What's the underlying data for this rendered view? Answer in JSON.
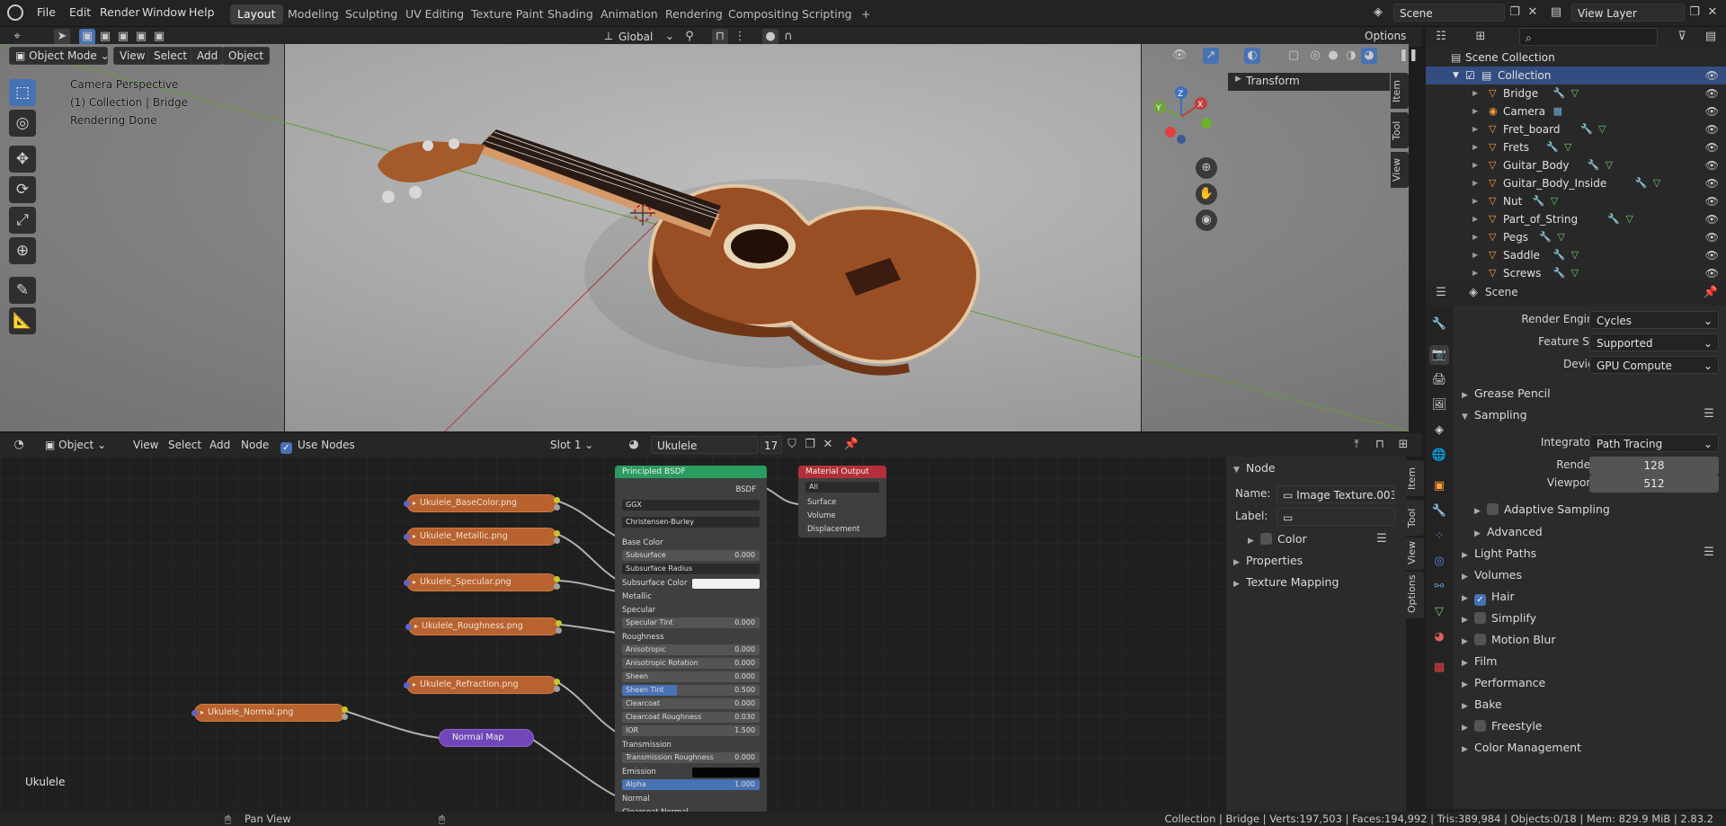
{
  "topbar": {
    "menus": [
      "File",
      "Edit",
      "Render",
      "Window",
      "Help"
    ],
    "workspaces": [
      "Layout",
      "Modeling",
      "Sculpting",
      "UV Editing",
      "Texture Paint",
      "Shading",
      "Animation",
      "Rendering",
      "Compositing",
      "Scripting"
    ],
    "active_workspace": "Layout",
    "scene": "Scene",
    "view_layer": "View Layer"
  },
  "viewport": {
    "header": {
      "orientation": "Global",
      "options": "Options"
    },
    "mode": "Object Mode",
    "menus": [
      "View",
      "Select",
      "Add",
      "Object"
    ],
    "overlay": [
      "Camera Perspective",
      "(1) Collection | Bridge",
      "Rendering Done"
    ],
    "side_tabs": [
      "Item",
      "Tool",
      "View"
    ],
    "transform_panel": "Transform"
  },
  "outliner": {
    "root": "Scene Collection",
    "collection": "Collection",
    "items": [
      "Bridge",
      "Camera",
      "Fret_board",
      "Frets",
      "Guitar_Body",
      "Guitar_Body_Inside",
      "Nut",
      "Part_of_String",
      "Pegs",
      "Saddle",
      "Screws"
    ]
  },
  "properties": {
    "scene": "Scene",
    "render_engine_label": "Render Engine",
    "render_engine": "Cycles",
    "feature_set_label": "Feature Set",
    "feature_set": "Supported",
    "device_label": "Device",
    "device": "GPU Compute",
    "grease_pencil": "Grease Pencil",
    "sampling": "Sampling",
    "integrator_label": "Integrator",
    "integrator": "Path Tracing",
    "render_label": "Render",
    "render_samples": "128",
    "viewport_label": "Viewport",
    "viewport_samples": "512",
    "adaptive_sampling": "Adaptive Sampling",
    "advanced": "Advanced",
    "light_paths": "Light Paths",
    "volumes": "Volumes",
    "hair": "Hair",
    "simplify": "Simplify",
    "motion_blur": "Motion Blur",
    "film": "Film",
    "performance": "Performance",
    "bake": "Bake",
    "freestyle": "Freestyle",
    "color_management": "Color Management"
  },
  "node_editor": {
    "type": "Object",
    "menus": [
      "View",
      "Select",
      "Add",
      "Node"
    ],
    "use_nodes": "Use Nodes",
    "slot": "Slot 1",
    "material": "Ukulele",
    "users": "17",
    "label_bottom": "Ukulele",
    "textures": [
      "Ukulele_BaseColor.png",
      "Ukulele_Metallic.png",
      "Ukulele_Specular.png",
      "Ukulele_Roughness.png",
      "Ukulele_Refraction.png",
      "Ukulele_Normal.png"
    ],
    "normal_map": "Normal Map",
    "bsdf": {
      "title": "Principled BSDF",
      "out": "BSDF",
      "dist": "GGX",
      "sss": "Christensen-Burley",
      "rows": [
        {
          "t": "socket",
          "l": "Base Color"
        },
        {
          "t": "field",
          "l": "Subsurface",
          "v": "0.000"
        },
        {
          "t": "field",
          "l": "Subsurface Radius",
          "v": ""
        },
        {
          "t": "socket",
          "l": "Subsurface Color"
        },
        {
          "t": "socket",
          "l": "Metallic"
        },
        {
          "t": "socket",
          "l": "Specular"
        },
        {
          "t": "field",
          "l": "Specular Tint",
          "v": "0.000"
        },
        {
          "t": "socket",
          "l": "Roughness"
        },
        {
          "t": "field",
          "l": "Anisotropic",
          "v": "0.000"
        },
        {
          "t": "field",
          "l": "Anisotropic Rotation",
          "v": "0.000"
        },
        {
          "t": "field",
          "l": "Sheen",
          "v": "0.000"
        },
        {
          "t": "field",
          "l": "Sheen Tint",
          "v": "0.500"
        },
        {
          "t": "field",
          "l": "Clearcoat",
          "v": "0.000"
        },
        {
          "t": "field",
          "l": "Clearcoat Roughness",
          "v": "0.030"
        },
        {
          "t": "field",
          "l": "IOR",
          "v": "1.500"
        },
        {
          "t": "socket",
          "l": "Transmission"
        },
        {
          "t": "field",
          "l": "Transmission Roughness",
          "v": "0.000"
        },
        {
          "t": "socket",
          "l": "Emission"
        },
        {
          "t": "field",
          "l": "Alpha",
          "v": "1.000"
        },
        {
          "t": "socket",
          "l": "Normal"
        },
        {
          "t": "socket",
          "l": "Clearcoat Normal"
        }
      ]
    },
    "output": {
      "title": "Material Output",
      "target": "All",
      "sockets": [
        "Surface",
        "Volume",
        "Displacement"
      ]
    },
    "side_tabs": [
      "Item",
      "Tool",
      "View",
      "Options"
    ],
    "node_panel": {
      "title": "Node",
      "name_label": "Name:",
      "name": "Image Texture.003",
      "label_label": "Label:",
      "color": "Color",
      "properties": "Properties",
      "texture_mapping": "Texture Mapping"
    }
  },
  "status": {
    "pan": "Pan View",
    "info": "Collection | Bridge | Verts:197,503 | Faces:194,992 | Tris:389,984 | Objects:0/18 | Mem: 829.9 MiB | 2.83.2"
  }
}
